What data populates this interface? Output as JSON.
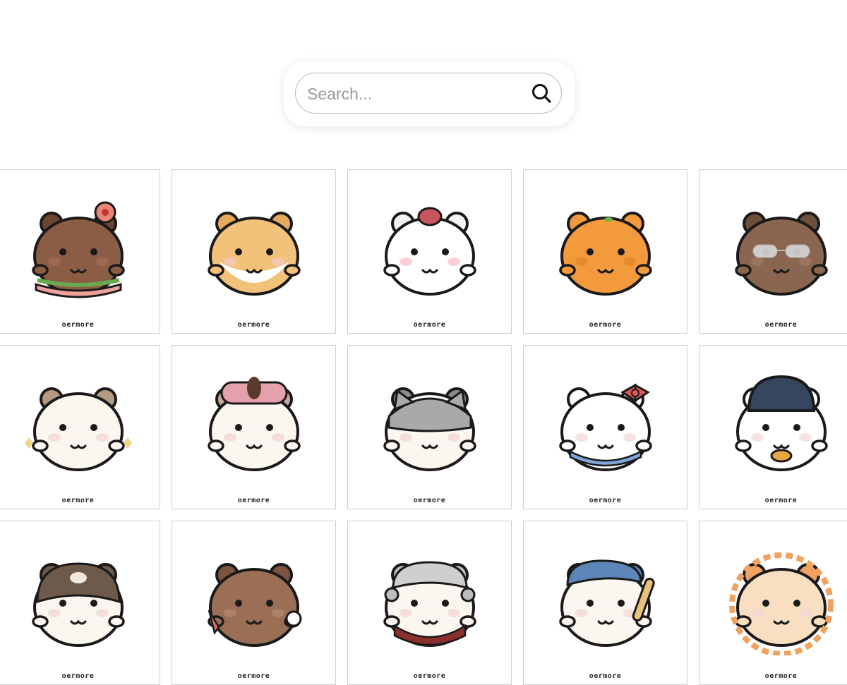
{
  "search": {
    "placeholder": "Search...",
    "value": ""
  },
  "items": [
    {
      "label": "oermore",
      "body": "#8a5d44",
      "belly": "#8a5d44",
      "ear": "#6e4733",
      "cheek": "#a86c52",
      "extra": "flower-burger",
      "accent": "#e98577"
    },
    {
      "label": "oermore",
      "body": "#f3c27a",
      "belly": "#ffffff",
      "ear": "#e7a95a",
      "cheek": "#f2c8c8",
      "extra": "none",
      "accent": "#f3c27a"
    },
    {
      "label": "oermore",
      "body": "#ffffff",
      "belly": "#ffffff",
      "ear": "#f3f3f3",
      "cheek": "#f8bcc4",
      "extra": "strawberry",
      "accent": "#c9565c"
    },
    {
      "label": "oermore",
      "body": "#f39a3c",
      "belly": "#f39a3c",
      "ear": "#f39a3c",
      "cheek": "#e2842a",
      "extra": "leaf",
      "accent": "#6ab04c"
    },
    {
      "label": "oermore",
      "body": "#8a6550",
      "belly": "#8a6550",
      "ear": "#6e4f3c",
      "cheek": "#a47c66",
      "extra": "glasses",
      "accent": "#d8d8d8"
    },
    {
      "label": "oermore",
      "body": "#fbf6f0",
      "belly": "#fbf6f0",
      "ear": "#b59a82",
      "cheek": "#f2d6d6",
      "extra": "sparkle",
      "accent": "#f2d68a"
    },
    {
      "label": "oermore",
      "body": "#fbf6f0",
      "belly": "#fbf6f0",
      "ear": "#c9a89a",
      "cheek": "#f2d6d6",
      "extra": "rollers",
      "accent": "#e4a0ac"
    },
    {
      "label": "oermore",
      "body": "#fbf6f0",
      "belly": "#fbf6f0",
      "ear": "#8c8c8c",
      "cheek": "#f2d6d6",
      "extra": "cat",
      "accent": "#a9a9a9"
    },
    {
      "label": "oermore",
      "body": "#ffffff",
      "belly": "#ffffff",
      "ear": "#ffffff",
      "cheek": "#f2d6d6",
      "extra": "bow",
      "accent": "#e0545e"
    },
    {
      "label": "oermore",
      "body": "#ffffff",
      "belly": "#ffffff",
      "ear": "#ffffff",
      "cheek": "#f2d6d6",
      "extra": "beanie",
      "accent": "#35465e"
    },
    {
      "label": "oermore",
      "body": "#fbf6f0",
      "belly": "#fbf6f0",
      "ear": "#6e5a4a",
      "cheek": "#f2d6d6",
      "extra": "otter",
      "accent": "#6e5a4a"
    },
    {
      "label": "oermore",
      "body": "#9a6f56",
      "belly": "#9a6f56",
      "ear": "#7b5440",
      "cheek": "#b58770",
      "extra": "rock",
      "accent": "#d76a6a"
    },
    {
      "label": "oermore",
      "body": "#fbf6f0",
      "belly": "#fbf6f0",
      "ear": "#bdbdbd",
      "cheek": "#f2d6d6",
      "extra": "wig",
      "accent": "#8a2e2e"
    },
    {
      "label": "oermore",
      "body": "#fbf6f0",
      "belly": "#fbf6f0",
      "ear": "#5c86b8",
      "cheek": "#f2d6d6",
      "extra": "baseball",
      "accent": "#e8c27a"
    },
    {
      "label": "oermore",
      "body": "#f9dfc2",
      "belly": "#f9dfc2",
      "ear": "#f0a260",
      "cheek": "#f2d6d6",
      "extra": "lion",
      "accent": "#f0a260"
    }
  ]
}
